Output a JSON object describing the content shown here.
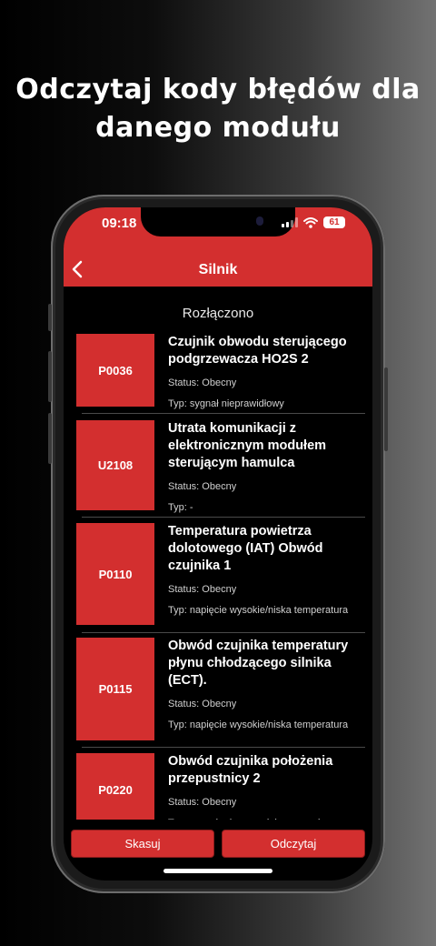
{
  "headline": {
    "line1": "Odczytaj kody błędów dla",
    "line2": "danego modułu"
  },
  "status_bar": {
    "time": "09:18",
    "battery": "61",
    "icons": [
      "signal-icon",
      "wifi-icon",
      "battery-icon"
    ]
  },
  "nav": {
    "back_icon": "chevron-left-icon",
    "title": "Silnik"
  },
  "connection_status": "Rozłączono",
  "codes": [
    {
      "code": "P0036",
      "title": "Czujnik obwodu sterującego podgrzewacza HO2S 2",
      "status": "Status: Obecny",
      "type": "Typ: sygnał nieprawidłowy"
    },
    {
      "code": "U2108",
      "title": "Utrata komunikacji z elektronicznym modułem sterującym hamulca",
      "status": "Status: Obecny",
      "type": "Typ: -"
    },
    {
      "code": "P0110",
      "title": "Temperatura powietrza dolotowego (IAT) Obwód czujnika 1",
      "status": "Status: Obecny",
      "type": "Typ: napięcie wysokie/niska temperatura"
    },
    {
      "code": "P0115",
      "title": "Obwód czujnika temperatury płynu chłodzącego silnika (ECT).",
      "status": "Status: Obecny",
      "type": "Typ: napięcie wysokie/niska temperatura"
    },
    {
      "code": "P0220",
      "title": "Obwód czujnika położenia przepustnicy 2",
      "status": "Status: Obecny",
      "type": "Typ: zwarcie do masy lub rozwarcie"
    }
  ],
  "actions": {
    "clear": "Skasuj",
    "read": "Odczytaj"
  },
  "colors": {
    "accent": "#d32f2f",
    "background": "#000000"
  }
}
